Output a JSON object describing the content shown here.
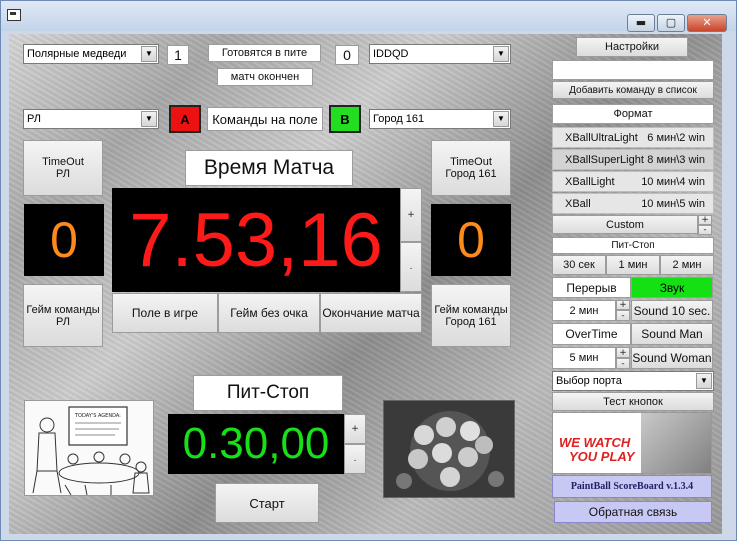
{
  "window": {
    "icon": "app-window-icon",
    "min_label": "▬",
    "max_label": "▢",
    "close_label": "✕"
  },
  "top": {
    "team_left_combo": "Полярные медведи",
    "score_left": "1",
    "status_top": "Готовятся в пите",
    "status_bottom": "матч окончен",
    "score_right": "0",
    "team_right_combo": "IDDQD"
  },
  "field": {
    "left_combo": "РЛ",
    "badge_a": "A",
    "center_label": "Команды на поле",
    "badge_b": "B",
    "right_combo": "Город 161"
  },
  "left_panel": {
    "timeout": "TimeOut\nРЛ",
    "score": "0",
    "game_button": "Гейм команды\nРЛ"
  },
  "right_panel": {
    "timeout": "TimeOut\nГород 161",
    "score": "0",
    "game_button": "Гейм команды\nГород 161"
  },
  "match": {
    "title": "Время Матча",
    "time": "7.53,16",
    "plus": "+",
    "minus": ".",
    "buttons": [
      "Поле в игре",
      "Гейм без очка",
      "Окончание матча"
    ]
  },
  "pit": {
    "title": "Пит-Стоп",
    "time": "0.30,00",
    "plus": "+",
    "minus": ".",
    "start": "Старт"
  },
  "settings": {
    "header": "Настройки",
    "team_input": "",
    "add_team": "Добавить команду в список",
    "format_label": "Формат",
    "formats": [
      {
        "name": "XBallUltraLight",
        "value": "6 мин\\2 win"
      },
      {
        "name": "XBallSuperLight",
        "value": "8 мин\\3 win"
      },
      {
        "name": "XBallLight",
        "value": "10 мин\\4 win"
      },
      {
        "name": "XBall",
        "value": "10 мин\\5 win"
      }
    ],
    "custom": "Custom",
    "pitstop_label": "Пит-Стоп",
    "pitstop_options": [
      "30 сек",
      "1 мин",
      "2 мин"
    ],
    "break_label": "Перерыв",
    "sound_label": "Звук",
    "break_value": "2 мин",
    "sound10": "Sound 10 sec.",
    "overtime_label": "OverTime",
    "sound_man": "Sound Man",
    "overtime_value": "5 мин",
    "sound_woman": "Sound Woman",
    "port_combo": "Выбор порта",
    "test_buttons": "Тест кнопок",
    "banner_line1": "WE WATCH",
    "banner_line2": "YOU PLAY",
    "version": "PaintBall ScoreBoard v.1.3.4",
    "feedback": "Обратная связь"
  },
  "cartoon": {
    "board_text": "TODAY'S AGENDA:"
  },
  "colors": {
    "red": "#ff1a1a",
    "orange": "#ff8a1c",
    "green": "#18e018",
    "accent_green": "#22dd22",
    "badge_red": "#ee1111"
  }
}
